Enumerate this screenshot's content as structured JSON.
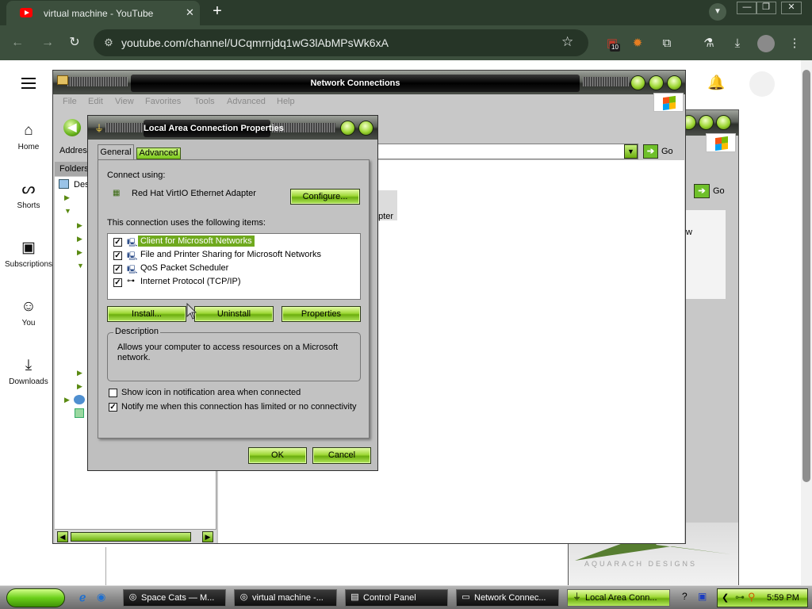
{
  "browser": {
    "tab_title": "virtual machine - YouTube",
    "tab_close": "✕",
    "new_tab": "+",
    "url": "youtube.com/channel/UCqmrnjdq1wG3lAbMPsWk6xA",
    "extension_badge": "10",
    "window_controls": [
      "—",
      "❐",
      "✕"
    ]
  },
  "youtube": {
    "sidebar": [
      {
        "label": "Home",
        "icon": "home-icon",
        "glyph": "⌂"
      },
      {
        "label": "Shorts",
        "icon": "shorts-icon",
        "glyph": "ᔕ"
      },
      {
        "label": "Subscriptions",
        "icon": "subscriptions-icon",
        "glyph": "▣"
      },
      {
        "label": "You",
        "icon": "user-icon",
        "glyph": "☺"
      },
      {
        "label": "Downloads",
        "icon": "download-icon",
        "glyph": "⤓"
      }
    ]
  },
  "network_connections": {
    "title": "Network Connections",
    "menu": [
      "File",
      "Edit",
      "View",
      "Favorites",
      "Tools",
      "Advanced",
      "Help"
    ],
    "address_label": "Addres",
    "folders_label": "Folders",
    "tree_root": "Des",
    "go_label": "Go",
    "partial_text": "apter"
  },
  "back_window": {
    "go_label": "Go",
    "partial_text": "w",
    "watermark": "AQUARACH DESIGNS"
  },
  "lan_dialog": {
    "title": "Local Area Connection Properties",
    "tabs": [
      "General",
      "Advanced"
    ],
    "connect_using_label": "Connect using:",
    "adapter": "Red Hat VirtIO Ethernet Adapter",
    "configure_button": "Configure...",
    "items_label": "This connection uses the following items:",
    "items": [
      {
        "label": "Client for Microsoft Networks",
        "checked": true,
        "selected": true
      },
      {
        "label": "File and Printer Sharing for Microsoft Networks",
        "checked": true,
        "selected": false
      },
      {
        "label": "QoS Packet Scheduler",
        "checked": true,
        "selected": false
      },
      {
        "label": "Internet Protocol (TCP/IP)",
        "checked": true,
        "selected": false
      }
    ],
    "install_button": "Install...",
    "uninstall_button": "Uninstall",
    "properties_button": "Properties",
    "description_label": "Description",
    "description_text": "Allows your computer to access resources on a Microsoft network.",
    "show_icon_label": "Show icon in notification area when connected",
    "show_icon_checked": false,
    "notify_label": "Notify me when this connection has limited or no connectivity",
    "notify_checked": true,
    "ok_button": "OK",
    "cancel_button": "Cancel"
  },
  "taskbar": {
    "tasks": [
      {
        "label": "Space Cats — M...",
        "icon": "firefox-icon",
        "active": false
      },
      {
        "label": "virtual machine -...",
        "icon": "firefox-icon",
        "active": false
      },
      {
        "label": "Control Panel",
        "icon": "control-panel-icon",
        "active": false
      },
      {
        "label": "Network Connec...",
        "icon": "folder-icon",
        "active": false
      },
      {
        "label": "Local Area Conn...",
        "icon": "network-icon",
        "active": true
      }
    ],
    "clock": "5:59 PM"
  }
}
